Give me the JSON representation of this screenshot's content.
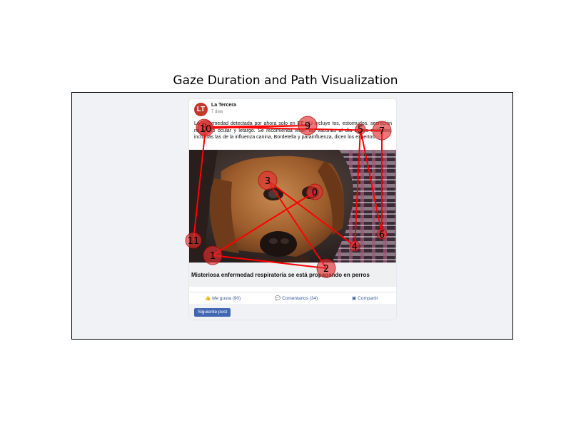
{
  "title": "Gaze Duration and Path Visualization",
  "post": {
    "avatar_initials": "LT",
    "page_name": "La Tercera",
    "time": "7 días",
    "text": "La enfermedad detectada por ahora solo en EE.UU incluye tos, estornudos, secreción nasal y/o ocular y letargo. Se recomienda tener las vacunas al día contra múltiples, incluidas las de la influenza canina, Bordetella y parainfluenza, dicen los expertos.",
    "headline": "Misteriosa enfermedad respiratoria se está propagando en perros",
    "actions": {
      "like_icon": "👍",
      "like": "Me gusta (90)",
      "comment_icon": "💬",
      "comment": "Comentarios (34)",
      "share_icon": "▣",
      "share": "Compartir"
    },
    "next_button": "Siguiente post"
  },
  "gaze": {
    "colors": {
      "path": "#ff0000",
      "fixation_fill": "#e03030",
      "fixation_stroke": "#b00000"
    },
    "fixations": [
      {
        "label": "0"
      },
      {
        "label": "1"
      },
      {
        "label": "2"
      },
      {
        "label": "3"
      },
      {
        "label": "4"
      },
      {
        "label": "5"
      },
      {
        "label": "6"
      },
      {
        "label": "7"
      },
      {
        "label": "8"
      },
      {
        "label": "9"
      },
      {
        "label": "10"
      },
      {
        "label": "11"
      }
    ]
  }
}
